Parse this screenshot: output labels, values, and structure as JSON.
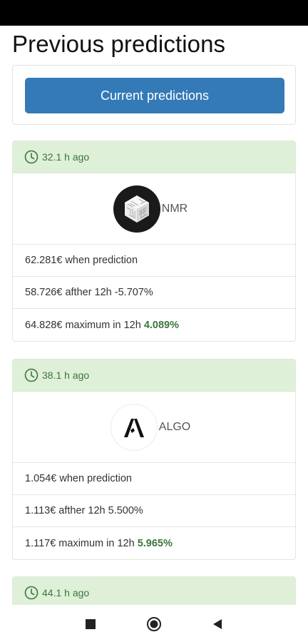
{
  "header": {
    "title": "Previous predictions"
  },
  "current_button": {
    "label": "Current predictions"
  },
  "predictions": [
    {
      "time_ago": "32.1 h ago",
      "coin": "NMR",
      "logo_icon": "nmr-logo-icon",
      "price_when_prediction": "62.281€ when prediction",
      "after_12h": "58.726€ afther 12h -5.707%",
      "maximum_prefix": "64.828€ maximum in 12h",
      "maximum_pct": "4.089%"
    },
    {
      "time_ago": "38.1 h ago",
      "coin": "ALGO",
      "logo_icon": "algo-logo-icon",
      "price_when_prediction": "1.054€ when prediction",
      "after_12h": "1.113€ afther 12h 5.500%",
      "maximum_prefix": "1.117€ maximum in 12h",
      "maximum_pct": "5.965%"
    },
    {
      "time_ago": "44.1 h ago"
    }
  ],
  "colors": {
    "header_bg": "#dff0d8",
    "header_text": "#3c763d",
    "button_bg": "#337ab7",
    "positive_pct": "#3c763d"
  },
  "nav_bar": {
    "icons": [
      "recent-apps-icon",
      "home-icon",
      "back-icon"
    ]
  }
}
